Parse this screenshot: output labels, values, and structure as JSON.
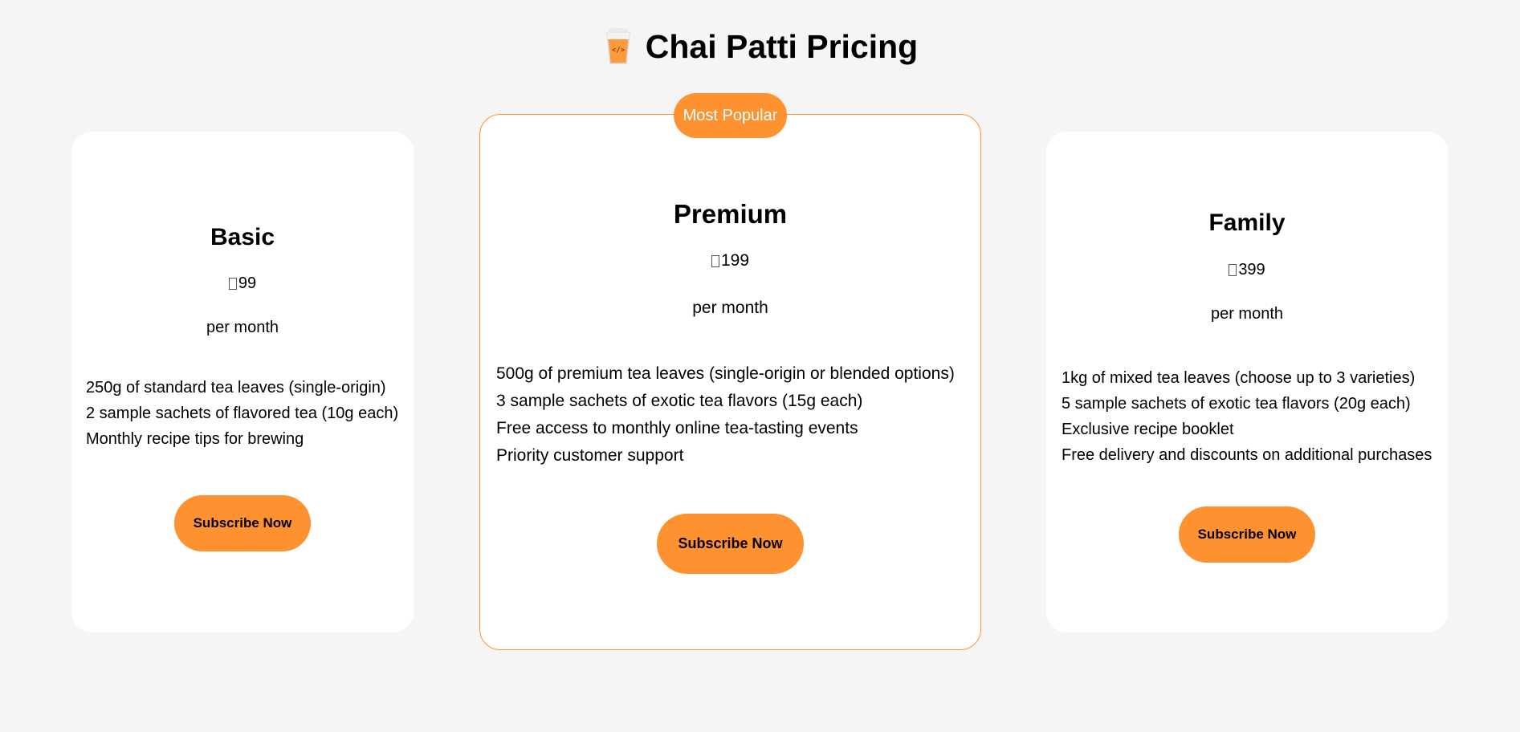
{
  "header": {
    "title": "Chai Patti Pricing",
    "logo_icon": "tea-glass-code-icon"
  },
  "colors": {
    "accent": "#ff9230",
    "background": "#f5f5f5",
    "card": "#ffffff"
  },
  "plans": [
    {
      "name": "Basic",
      "price": "99",
      "period": "per month",
      "features": [
        "250g of standard tea leaves (single-origin)",
        "2 sample sachets of flavored tea (10g each)",
        "Monthly recipe tips for brewing"
      ],
      "button_label": "Subscribe Now"
    },
    {
      "name": "Premium",
      "badge": "Most Popular",
      "price": "199",
      "period": "per month",
      "features": [
        "500g of premium tea leaves (single-origin or blended options)",
        "3 sample sachets of exotic tea flavors (15g each)",
        "Free access to monthly online tea-tasting events",
        "Priority customer support"
      ],
      "button_label": "Subscribe Now"
    },
    {
      "name": "Family",
      "price": "399",
      "period": "per month",
      "features": [
        "1kg of mixed tea leaves (choose up to 3 varieties)",
        "5 sample sachets of exotic tea flavors (20g each)",
        "Exclusive recipe booklet",
        "Free delivery and discounts on additional purchases"
      ],
      "button_label": "Subscribe Now"
    }
  ]
}
